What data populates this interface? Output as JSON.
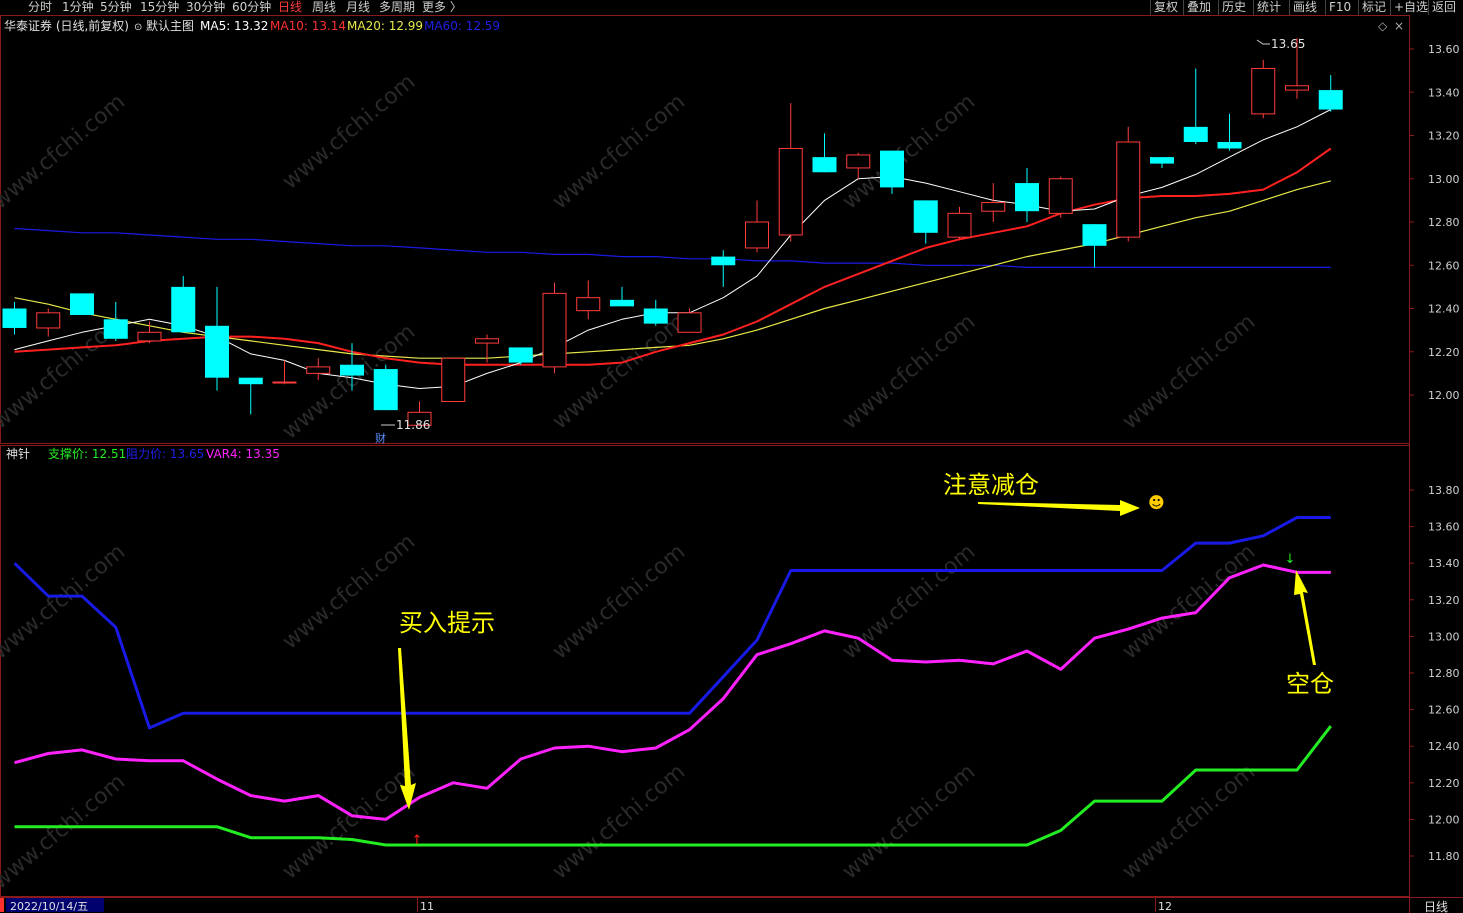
{
  "toolbar": {
    "timeframes": [
      "分时",
      "1分钟",
      "5分钟",
      "15分钟",
      "30分钟",
      "60分钟",
      "日线",
      "周线",
      "月线",
      "多周期",
      "更多 〉"
    ],
    "active": "日线",
    "right_buttons": [
      "复权",
      "叠加",
      "历史",
      "统计",
      "画线",
      "F10",
      "标记",
      "+自选",
      "返回"
    ]
  },
  "main_header": {
    "title": "华泰证券 (日线,前复权)",
    "template": "默认主图",
    "ma5": "MA5: 13.32",
    "ma10": "MA10: 13.14",
    "ma20": "MA20: 12.99",
    "ma60": "MA60: 12.59"
  },
  "ind_header": {
    "name": "神针",
    "support": "支撑价: 12.51",
    "resist": "阻力价: 13.65",
    "var4": "VAR4: 13.35"
  },
  "colors": {
    "up": "#ff3c3c",
    "down": "#00ffff",
    "ma5": "#ffffff",
    "ma10": "#ff2020",
    "ma20": "#e8e84a",
    "ma60": "#1a1ae6",
    "support": "#22ee22",
    "resist": "#1a1ae6",
    "var4": "#ff22ff",
    "annotation": "#ffff00"
  },
  "annotations": {
    "high_label": "13.65",
    "low_label": "11.86",
    "cai_marker": "财",
    "buy_hint": "买入提示",
    "reduce_warning": "注意减仓",
    "empty_position": "空仓",
    "smiley": "☻"
  },
  "x_axis": {
    "date": "2022/10/14/五",
    "month_11": "11",
    "month_12": "12",
    "period": "日线"
  },
  "chart_data": [
    {
      "type": "candlestick",
      "title": "华泰证券 (日线,前复权)",
      "ylim": [
        11.8,
        13.7
      ],
      "yticks": [
        12.0,
        12.2,
        12.4,
        12.6,
        12.8,
        13.0,
        13.2,
        13.4,
        13.6
      ],
      "ohlc": [
        [
          12.4,
          12.43,
          12.28,
          12.31
        ],
        [
          12.31,
          12.4,
          12.27,
          12.38
        ],
        [
          12.47,
          12.47,
          12.38,
          12.37
        ],
        [
          12.35,
          12.43,
          12.25,
          12.26
        ],
        [
          12.25,
          12.34,
          12.24,
          12.29
        ],
        [
          12.5,
          12.55,
          12.29,
          12.29
        ],
        [
          12.32,
          12.5,
          12.02,
          12.08
        ],
        [
          12.08,
          12.08,
          11.91,
          12.05
        ],
        [
          12.06,
          12.16,
          12.05,
          12.06
        ],
        [
          12.1,
          12.17,
          12.07,
          12.13
        ],
        [
          12.14,
          12.24,
          12.02,
          12.09
        ],
        [
          12.12,
          12.14,
          11.93,
          11.93
        ],
        [
          11.86,
          11.97,
          11.86,
          11.92
        ],
        [
          11.97,
          12.17,
          11.97,
          12.17
        ],
        [
          12.24,
          12.28,
          12.15,
          12.26
        ],
        [
          12.22,
          12.22,
          12.14,
          12.15
        ],
        [
          12.13,
          12.52,
          12.1,
          12.47
        ],
        [
          12.39,
          12.53,
          12.35,
          12.45
        ],
        [
          12.44,
          12.5,
          12.42,
          12.41
        ],
        [
          12.4,
          12.44,
          12.32,
          12.33
        ],
        [
          12.29,
          12.4,
          12.3,
          12.38
        ],
        [
          12.64,
          12.67,
          12.5,
          12.6
        ],
        [
          12.68,
          12.9,
          12.66,
          12.8
        ],
        [
          12.74,
          13.35,
          12.71,
          13.14
        ],
        [
          13.1,
          13.21,
          13.03,
          13.03
        ],
        [
          13.05,
          13.12,
          13.0,
          13.11
        ],
        [
          13.13,
          13.13,
          12.93,
          12.96
        ],
        [
          12.9,
          12.9,
          12.7,
          12.75
        ],
        [
          12.73,
          12.87,
          12.72,
          12.84
        ],
        [
          12.85,
          12.98,
          12.8,
          12.89
        ],
        [
          12.98,
          13.05,
          12.8,
          12.85
        ],
        [
          12.84,
          13.01,
          12.82,
          13.0
        ],
        [
          12.79,
          12.79,
          12.59,
          12.69
        ],
        [
          12.73,
          13.24,
          12.71,
          13.17
        ],
        [
          13.1,
          13.1,
          13.05,
          13.07
        ],
        [
          13.24,
          13.51,
          13.16,
          13.17
        ],
        [
          13.17,
          13.3,
          13.13,
          13.14
        ],
        [
          13.3,
          13.55,
          13.28,
          13.51
        ],
        [
          13.41,
          13.65,
          13.37,
          13.43
        ],
        [
          13.41,
          13.48,
          13.31,
          13.32
        ]
      ],
      "ma5": [
        12.21,
        12.25,
        12.29,
        12.32,
        12.35,
        12.32,
        12.27,
        12.19,
        12.16,
        12.1,
        12.08,
        12.05,
        12.03,
        12.04,
        12.1,
        12.15,
        12.22,
        12.3,
        12.35,
        12.38,
        12.38,
        12.45,
        12.55,
        12.74,
        12.9,
        13.0,
        13.01,
        12.98,
        12.94,
        12.9,
        12.88,
        12.85,
        12.86,
        12.92,
        12.96,
        13.02,
        13.1,
        13.18,
        13.24,
        13.32
      ],
      "ma10": [
        12.2,
        12.21,
        12.22,
        12.23,
        12.25,
        12.26,
        12.27,
        12.27,
        12.26,
        12.24,
        12.2,
        12.17,
        12.15,
        12.14,
        12.14,
        12.14,
        12.14,
        12.14,
        12.15,
        12.2,
        12.24,
        12.28,
        12.34,
        12.42,
        12.5,
        12.56,
        12.62,
        12.68,
        12.72,
        12.75,
        12.78,
        12.84,
        12.88,
        12.91,
        12.92,
        12.92,
        12.93,
        12.95,
        13.03,
        13.14
      ],
      "ma20": [
        12.45,
        12.42,
        12.38,
        12.35,
        12.32,
        12.29,
        12.27,
        12.25,
        12.23,
        12.21,
        12.19,
        12.18,
        12.17,
        12.17,
        12.17,
        12.18,
        12.19,
        12.2,
        12.21,
        12.22,
        12.23,
        12.26,
        12.3,
        12.35,
        12.4,
        12.44,
        12.48,
        12.52,
        12.56,
        12.6,
        12.64,
        12.67,
        12.7,
        12.74,
        12.78,
        12.82,
        12.85,
        12.9,
        12.95,
        12.99
      ],
      "ma60": [
        12.77,
        12.76,
        12.75,
        12.75,
        12.74,
        12.73,
        12.72,
        12.72,
        12.71,
        12.7,
        12.69,
        12.69,
        12.68,
        12.67,
        12.66,
        12.66,
        12.65,
        12.65,
        12.64,
        12.64,
        12.63,
        12.63,
        12.62,
        12.62,
        12.61,
        12.61,
        12.61,
        12.6,
        12.6,
        12.6,
        12.59,
        12.59,
        12.59,
        12.59,
        12.59,
        12.59,
        12.59,
        12.59,
        12.59,
        12.59
      ]
    },
    {
      "type": "line",
      "title": "神针",
      "ylim": [
        11.7,
        13.95
      ],
      "yticks": [
        11.8,
        12.0,
        12.2,
        12.4,
        12.6,
        12.8,
        13.0,
        13.2,
        13.4,
        13.6,
        13.8
      ],
      "series": [
        {
          "name": "支撑价",
          "values": [
            11.96,
            11.96,
            11.96,
            11.96,
            11.96,
            11.96,
            11.96,
            11.9,
            11.9,
            11.9,
            11.89,
            11.86,
            11.86,
            11.86,
            11.86,
            11.86,
            11.86,
            11.86,
            11.86,
            11.86,
            11.86,
            11.86,
            11.86,
            11.86,
            11.86,
            11.86,
            11.86,
            11.86,
            11.86,
            11.86,
            11.86,
            11.94,
            12.1,
            12.1,
            12.1,
            12.27,
            12.27,
            12.27,
            12.27,
            12.51
          ]
        },
        {
          "name": "阻力价",
          "values": [
            13.4,
            13.22,
            13.22,
            13.05,
            12.5,
            12.58,
            12.58,
            12.58,
            12.58,
            12.58,
            12.58,
            12.58,
            12.58,
            12.58,
            12.58,
            12.58,
            12.58,
            12.58,
            12.58,
            12.58,
            12.58,
            12.78,
            12.98,
            13.36,
            13.36,
            13.36,
            13.36,
            13.36,
            13.36,
            13.36,
            13.36,
            13.36,
            13.36,
            13.36,
            13.36,
            13.51,
            13.51,
            13.55,
            13.65,
            13.65
          ]
        },
        {
          "name": "VAR4",
          "values": [
            12.31,
            12.36,
            12.38,
            12.33,
            12.32,
            12.32,
            12.22,
            12.13,
            12.1,
            12.13,
            12.02,
            12.0,
            12.12,
            12.2,
            12.17,
            12.33,
            12.39,
            12.4,
            12.37,
            12.39,
            12.49,
            12.66,
            12.9,
            12.96,
            13.03,
            12.99,
            12.87,
            12.86,
            12.87,
            12.85,
            12.92,
            12.82,
            12.99,
            13.04,
            13.1,
            13.13,
            13.32,
            13.39,
            13.35,
            13.35
          ]
        }
      ]
    }
  ]
}
